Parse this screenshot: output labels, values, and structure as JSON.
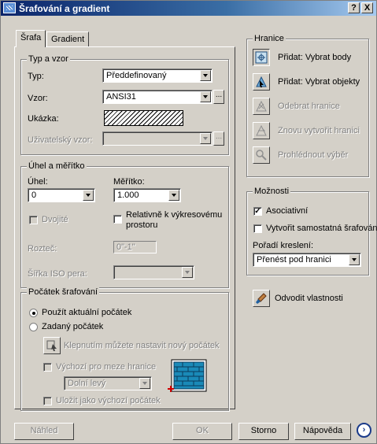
{
  "window": {
    "title": "Šrafování a gradient",
    "help_btn": "?",
    "close_btn": "X"
  },
  "tabs": [
    {
      "label": "Šrafa"
    },
    {
      "label": "Gradient"
    }
  ],
  "typ_vzor": {
    "group_label": "Typ a vzor",
    "typ_label": "Typ:",
    "typ_value": "Předdefinovaný",
    "vzor_label": "Vzor:",
    "vzor_value": "ANSI31",
    "ukazka_label": "Ukázka:",
    "uzivatelsky_label": "Uživatelský vzor:",
    "uzivatelsky_value": ""
  },
  "uhel_meritko": {
    "group_label": "Úhel a měřítko",
    "uhel_label": "Úhel:",
    "uhel_value": "0",
    "meritko_label": "Měřítko:",
    "meritko_value": "1.000",
    "dvojite_label": "Dvojité",
    "relativne_label_1": "Relativně k výkresovému",
    "relativne_label_2": "prostoru",
    "roztec_label": "Rozteč:",
    "roztec_value": "0\"-1\"",
    "sirka_iso_label": "Šířka ISO pera:",
    "sirka_iso_value": ""
  },
  "pocatek": {
    "group_label": "Počátek šrafování",
    "pouzit_label": "Použít aktuální počátek",
    "zadany_label": "Zadaný počátek",
    "klepnutim_label": "Klepnutím můžete nastavit nový počátek",
    "vychozi_label": "Výchozí pro meze hranice",
    "dolni_value": "Dolní levý",
    "ulozit_label": "Uložit jako výchozí počátek"
  },
  "hranice": {
    "group_label": "Hranice",
    "pridat_body": "Přidat: Vybrat body",
    "pridat_objekty": "Přidat: Vybrat objekty",
    "odebrat": "Odebrat hranice",
    "znovu": "Znovu vytvořit hranici",
    "prohlednout": "Prohlédnout výběr"
  },
  "moznosti": {
    "group_label": "Možnosti",
    "asociativni": "Asociativní",
    "samostatna": "Vytvořit samostatná šrafování",
    "poradi_label": "Pořadí kreslení:",
    "poradi_value": "Přenést pod hranici"
  },
  "odvodit": "Odvodit vlastnosti",
  "buttons": {
    "nahled": "Náhled",
    "ok": "OK",
    "storno": "Storno",
    "napoveda": "Nápověda"
  },
  "colors": {
    "title_start": "#0a246a",
    "title_end": "#a6caf0",
    "face": "#d4d0c8"
  }
}
